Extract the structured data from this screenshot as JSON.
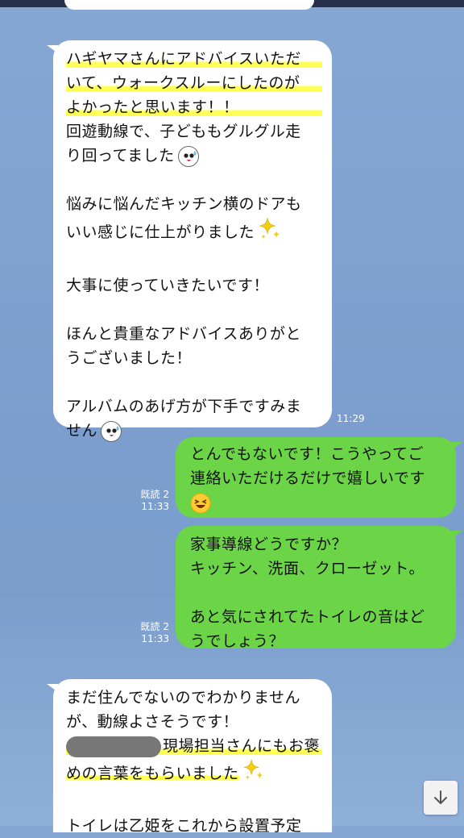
{
  "messages": [
    {
      "side": "in",
      "lines": [
        "ハギヤマさんにアドバイスいただ",
        "いて、ウォークスルーにしたのが",
        "よかったと思います！！",
        "回遊動線で、子どももグルグル走",
        "り回ってました",
        "悩みに悩んだキッチン横のドアも",
        "いい感じに仕上がりました",
        "大事に使っていきたいです！",
        "ほんと貴重なアドバイスありがと",
        "うございました！",
        "アルバムのあげ方が下手ですみま",
        "せん"
      ],
      "time": "11:29"
    },
    {
      "side": "out",
      "lines": [
        "とんでもないです！こうやってご",
        "連絡いただけるだけで嬉しいです"
      ],
      "read": "既読 2",
      "time": "11:33"
    },
    {
      "side": "out",
      "lines": [
        "家事導線どうですか？",
        "キッチン、洗面、クローゼット。",
        "あと気にされてたトイレの音はど",
        "うでしょう？"
      ],
      "read": "既読 2",
      "time": "11:33"
    },
    {
      "side": "in",
      "lines": [
        "まだ住んでないのでわかりません",
        "が、動線よさそうです！",
        "現場担当さんにもお褒",
        "めの言葉をもらいました",
        "トイレは乙姫をこれから設置予定"
      ]
    }
  ],
  "icons": {
    "face": "sweat-face-icon",
    "sparkle": "sparkle-icon",
    "smile": "laughing-face-icon",
    "scroll": "arrow-down-icon"
  },
  "colors": {
    "incoming": "#ffffff",
    "outgoing": "#6cd447",
    "highlight": "#ffff55",
    "background": "#7c9fcf"
  }
}
